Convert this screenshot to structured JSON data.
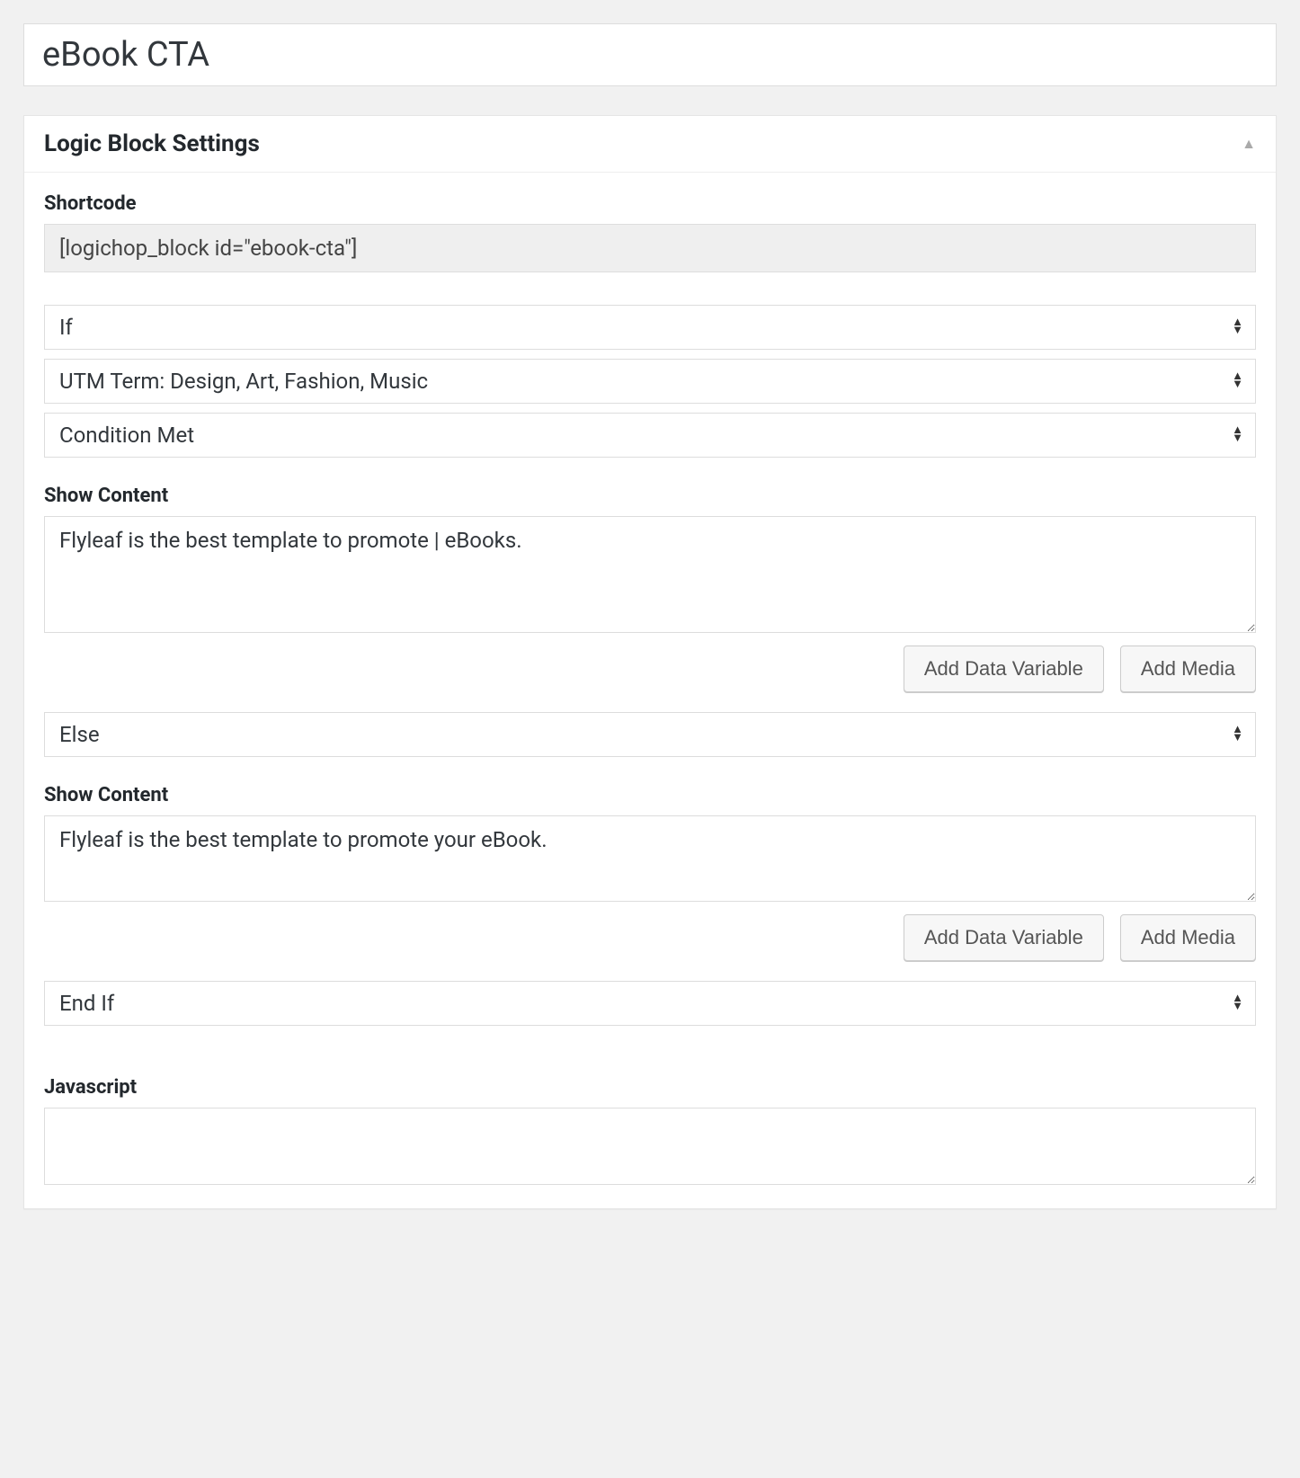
{
  "title": "eBook CTA",
  "panel": {
    "heading": "Logic Block Settings",
    "shortcode": {
      "label": "Shortcode",
      "value": "[logichop_block id=\"ebook-cta\"]"
    },
    "block1": {
      "logic_type": "If",
      "condition_source": "UTM Term: Design, Art, Fashion, Music",
      "condition_state": "Condition Met",
      "show_content_label": "Show Content",
      "show_content_value": "Flyleaf is the best template to promote | eBooks.",
      "add_data_variable": "Add Data Variable",
      "add_media": "Add Media"
    },
    "block2": {
      "logic_type": "Else",
      "show_content_label": "Show Content",
      "show_content_value": "Flyleaf is the best template to promote your eBook.",
      "add_data_variable": "Add Data Variable",
      "add_media": "Add Media"
    },
    "block3": {
      "logic_type": "End If"
    },
    "javascript": {
      "label": "Javascript",
      "value": ""
    }
  }
}
